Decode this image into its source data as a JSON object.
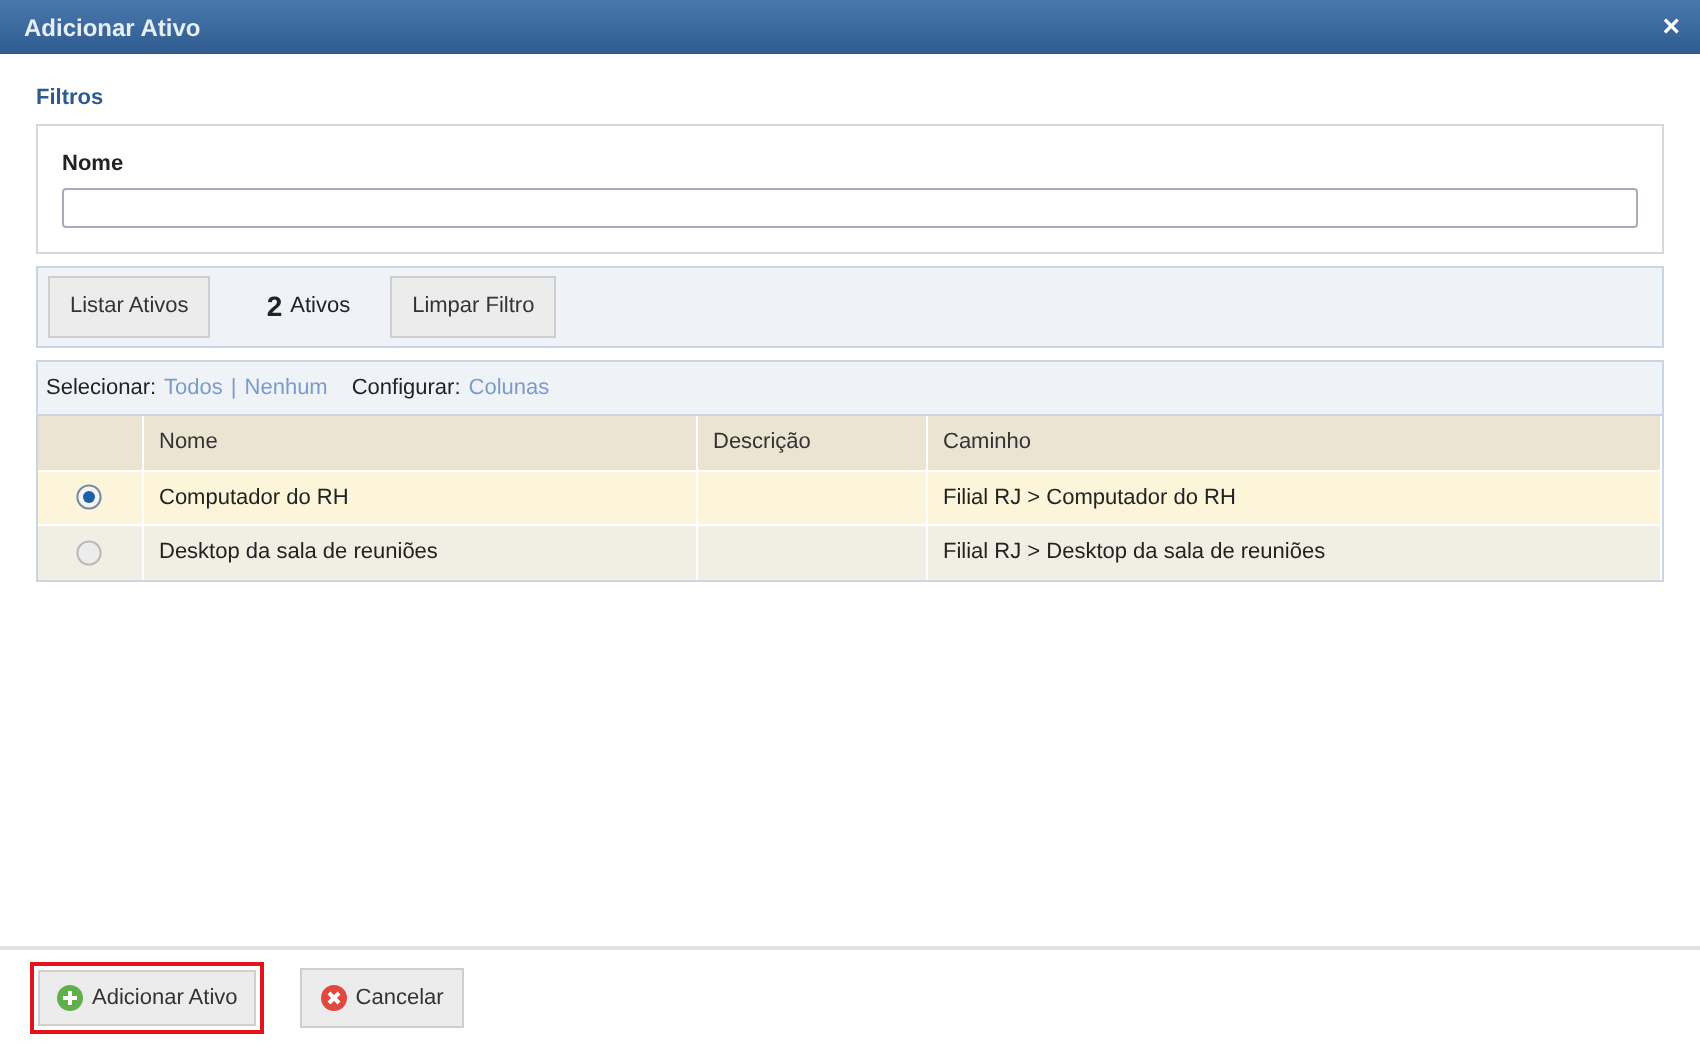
{
  "window": {
    "title": "Adicionar Ativo",
    "close": "×"
  },
  "filters": {
    "title": "Filtros",
    "name_label": "Nome"
  },
  "toolbar": {
    "list_button": "Listar Ativos",
    "count": "2",
    "count_label": "Ativos",
    "clear_button": "Limpar Filtro"
  },
  "selection_bar": {
    "select_label": "Selecionar:",
    "all": "Todos",
    "separator": "|",
    "none": "Nenhum",
    "configure_label": "Configurar:",
    "columns": "Colunas"
  },
  "table": {
    "columns": [
      "Nome",
      "Descrição",
      "Caminho"
    ],
    "rows": [
      {
        "selected": true,
        "cells": [
          "Computador do RH",
          "",
          "Filial RJ > Computador do RH"
        ]
      },
      {
        "selected": false,
        "cells": [
          "Desktop da sala de reuniões",
          "",
          "Filial RJ > Desktop da sala de reuniões"
        ]
      }
    ]
  },
  "buttons": [
    {
      "kind": "add",
      "label": "Adicionar Ativo",
      "highlighted": true
    },
    {
      "kind": "cancel",
      "label": "Cancelar",
      "highlighted": false
    }
  ]
}
